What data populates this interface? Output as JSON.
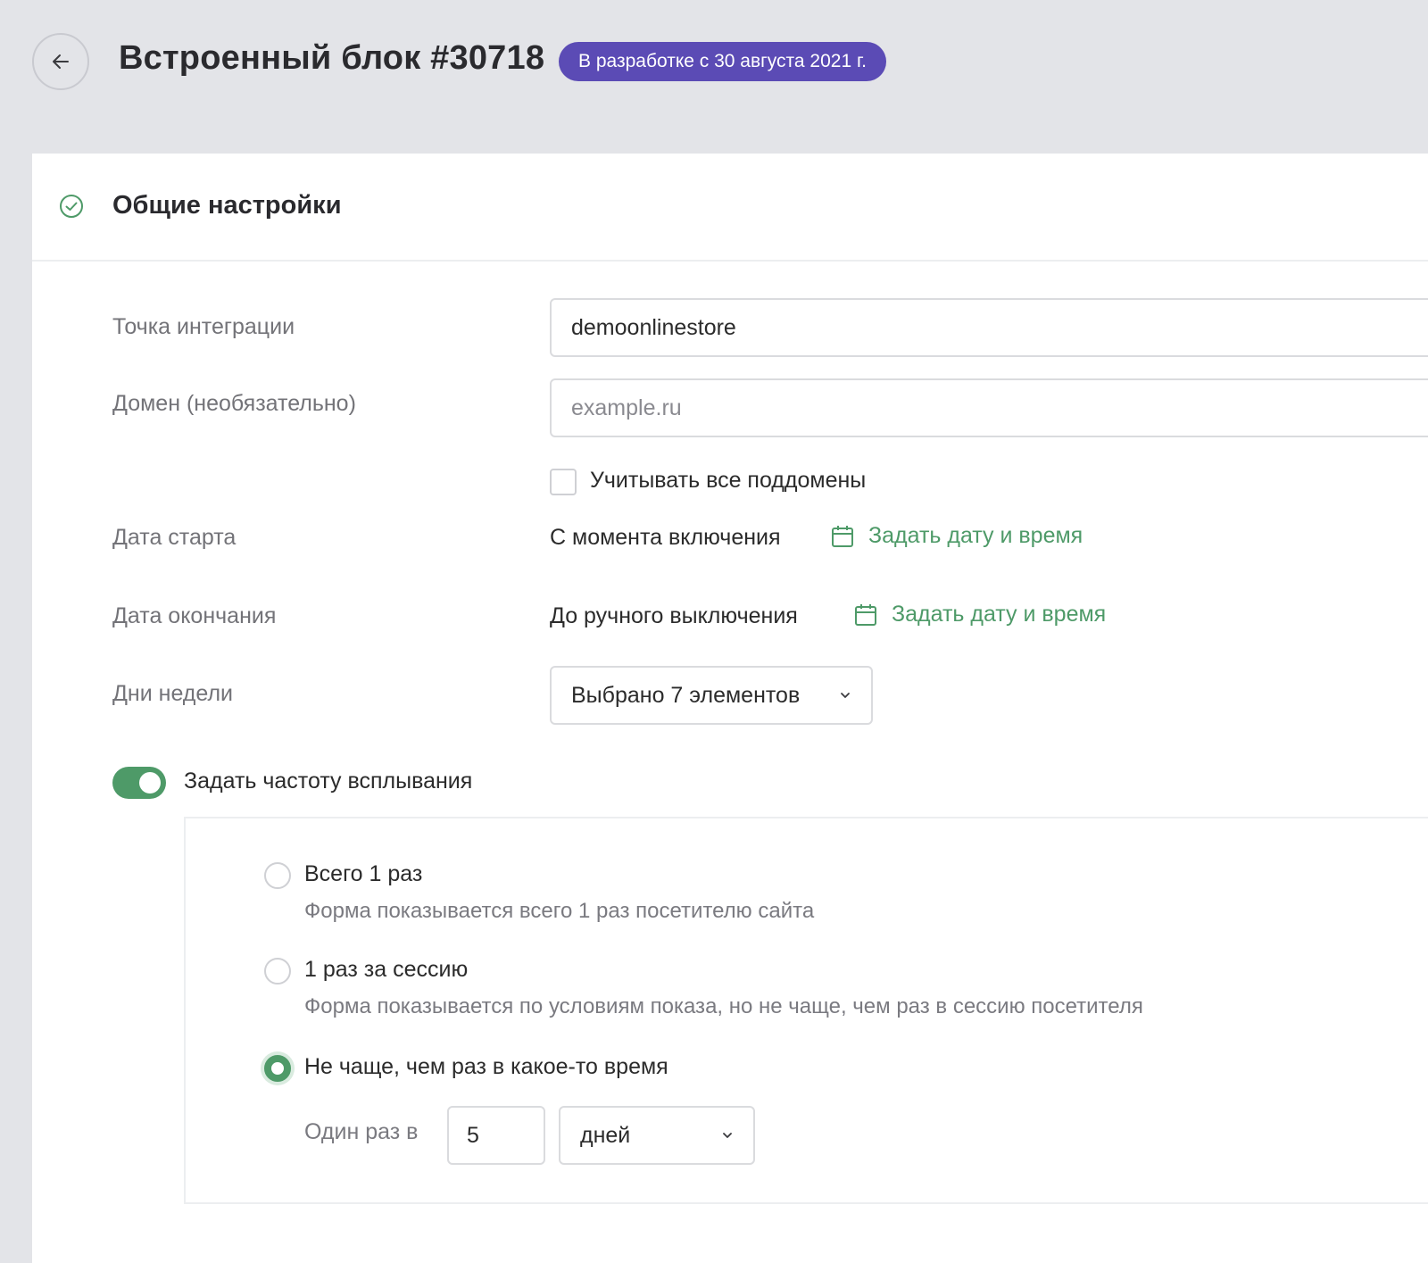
{
  "header": {
    "title": "Встроенный блок #30718",
    "status_badge": "В разработке с 30 августа 2021 г."
  },
  "section": {
    "title": "Общие настройки"
  },
  "form": {
    "integration_point": {
      "label": "Точка интеграции",
      "value": "demoonlinestore"
    },
    "domain": {
      "label": "Домен (необязательно)",
      "value": "",
      "placeholder": "example.ru"
    },
    "subdomains_checkbox": {
      "label": "Учитывать все поддомены",
      "checked": false
    },
    "start_date": {
      "label": "Дата старта",
      "value": "С момента включения",
      "link": "Задать дату и время"
    },
    "end_date": {
      "label": "Дата окончания",
      "value": "До ручного выключения",
      "link": "Задать дату и время"
    },
    "weekdays": {
      "label": "Дни недели",
      "selected": "Выбрано 7 элементов"
    }
  },
  "frequency": {
    "toggle_label": "Задать частоту всплывания",
    "enabled": true,
    "options": [
      {
        "title": "Всего 1 раз",
        "description": "Форма показывается всего 1 раз посетителю сайта",
        "selected": false
      },
      {
        "title": "1 раз за сессию",
        "description": "Форма показывается по условиям показа, но не чаще, чем раз в сессию посетителя",
        "selected": false
      },
      {
        "title": "Не чаще, чем раз в какое-то время",
        "selected": true
      }
    ],
    "interval": {
      "label": "Один раз в",
      "value": "5",
      "unit": "дней"
    }
  },
  "colors": {
    "accent_green": "#4e9a68",
    "badge_purple": "#5b4bb5",
    "background": "#e3e4e8"
  },
  "icons": [
    "arrow-left-icon",
    "check-circle-icon",
    "calendar-icon",
    "chevron-down-icon"
  ]
}
